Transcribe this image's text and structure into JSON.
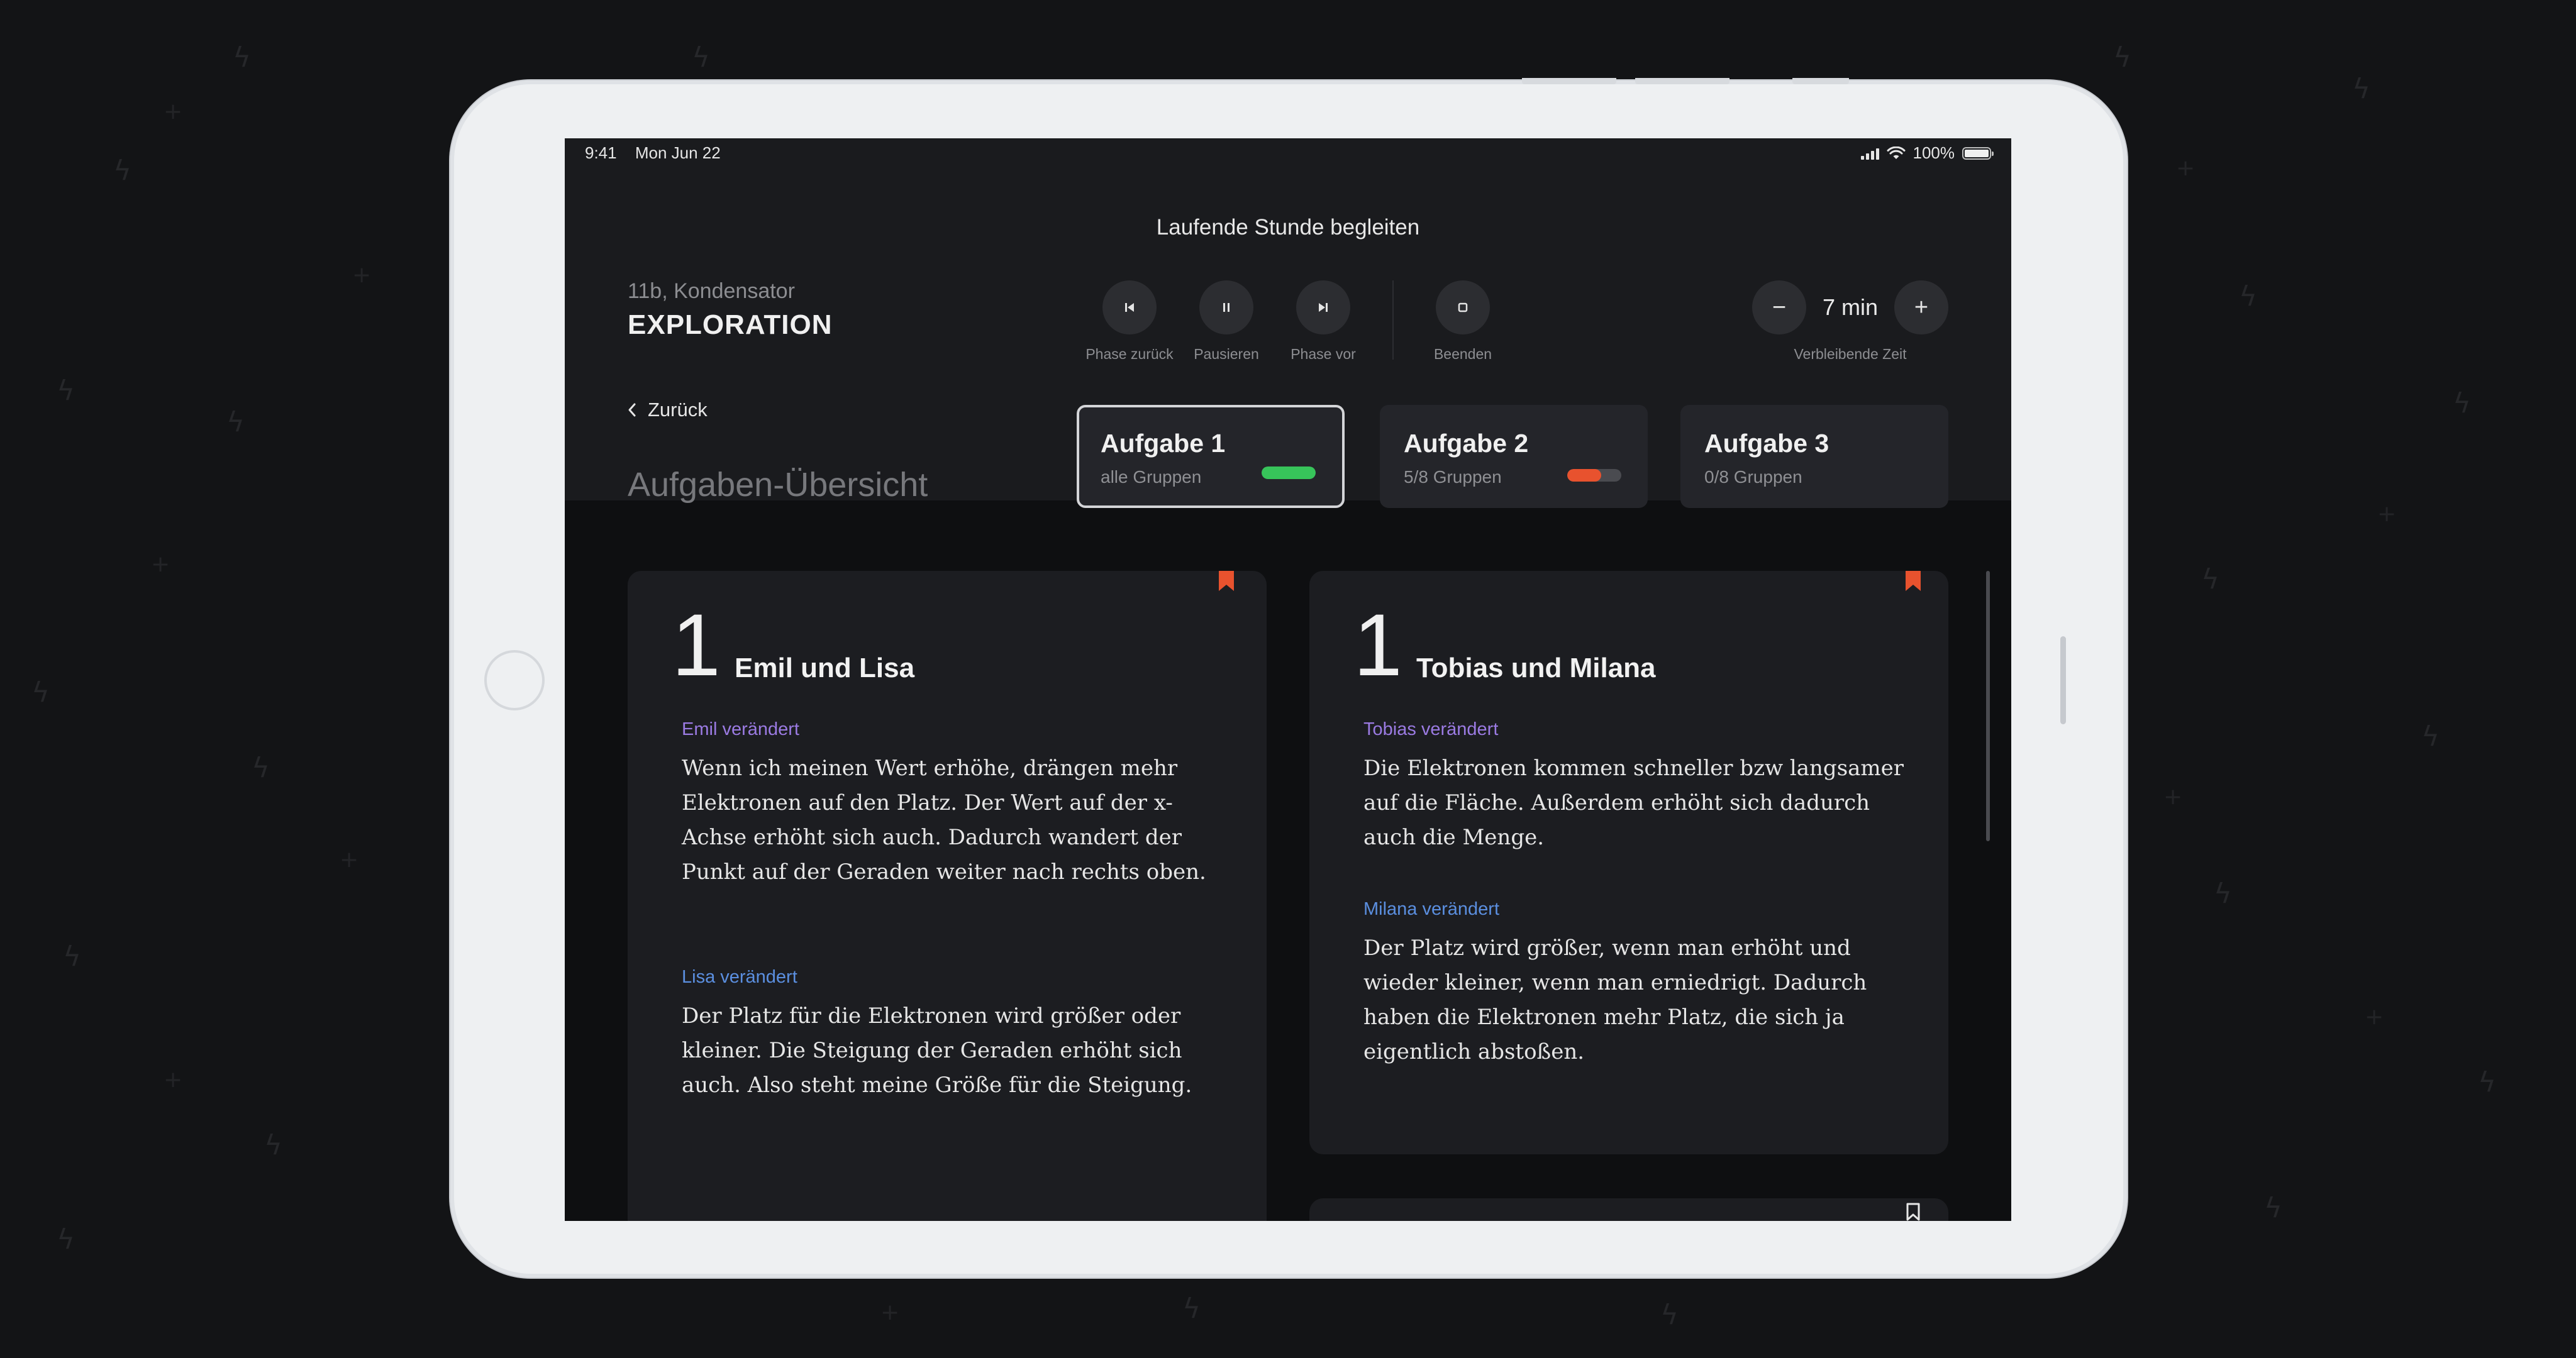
{
  "status_bar": {
    "time": "9:41",
    "date": "Mon Jun 22",
    "battery": "100%"
  },
  "header": {
    "title": "Laufende Stunde begleiten",
    "lesson_subtitle": "11b, Kondensator",
    "lesson_phase": "EXPLORATION",
    "controls": {
      "phase_back": "Phase zurück",
      "pause": "Pausieren",
      "phase_forward": "Phase vor",
      "end": "Beenden"
    },
    "timer": {
      "minus": "−",
      "value": "7 min",
      "plus": "+",
      "label": "Verbleibende Zeit"
    }
  },
  "nav": {
    "back": "Zurück"
  },
  "page_title": "Aufgaben-Übersicht",
  "tasks": [
    {
      "title": "Aufgabe 1",
      "subtitle": "alle Gruppen",
      "progress": 1.0,
      "color": "#37c45a"
    },
    {
      "title": "Aufgabe 2",
      "subtitle": "5/8 Gruppen",
      "progress": 0.625,
      "color": "#e8522e"
    },
    {
      "title": "Aufgabe 3",
      "subtitle": "0/8 Gruppen",
      "progress": 0
    }
  ],
  "groups": [
    {
      "number": "1",
      "names": "Emil und Lisa",
      "bookmarked": true,
      "entries": [
        {
          "who": "Emil  verändert",
          "color": "#9b7be3",
          "text": "Wenn ich meinen Wert erhöhe, drängen mehr Elektronen auf den Platz. Der Wert auf der x-Achse erhöht sich auch. Dadurch wandert der Punkt auf der Geraden weiter nach rechts oben."
        },
        {
          "who": "Lisa verändert",
          "color": "#5b8fe0",
          "text": "Der Platz für die Elektronen wird größer oder kleiner. Die Steigung der Geraden erhöht sich auch. Also steht meine Größe für die Steigung."
        }
      ]
    },
    {
      "number": "1",
      "names": "Tobias und Milana",
      "bookmarked": true,
      "entries": [
        {
          "who": "Tobias verändert",
          "color": "#9b7be3",
          "text": "Die Elektronen kommen schneller bzw langsamer auf die Fläche. Außerdem erhöht sich dadurch auch die Menge."
        },
        {
          "who": "Milana verändert",
          "color": "#5b8fe0",
          "text": "Der Platz wird größer, wenn man erhöht und wieder kleiner, wenn man erniedrigt. Dadurch haben die Elektronen mehr Platz, die sich ja eigentlich abstoßen."
        }
      ]
    }
  ],
  "colors": {
    "bookmark_active": "#e8522e",
    "bookmark_inactive": "#e6e6e6"
  }
}
